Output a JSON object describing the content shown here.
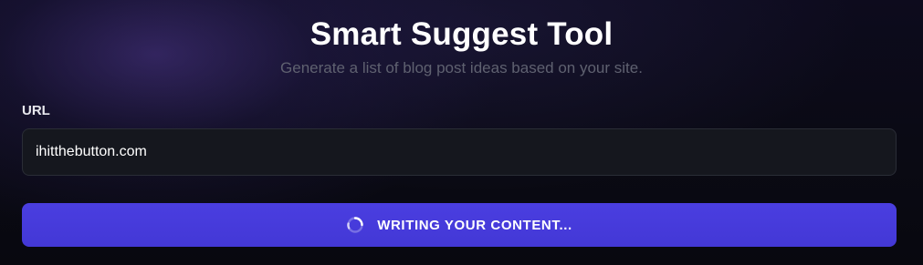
{
  "header": {
    "title": "Smart Suggest Tool",
    "subtitle": "Generate a list of blog post ideas based on your site."
  },
  "form": {
    "url_label": "URL",
    "url_value": "ihitthebutton.com",
    "submit_label": "WRITING YOUR CONTENT...",
    "submit_icon": "loading-spinner-icon"
  },
  "colors": {
    "accent": "#4a3ee0",
    "background": "#0a0a14",
    "input_background": "#15171e",
    "subtitle_text": "#5f6170"
  }
}
